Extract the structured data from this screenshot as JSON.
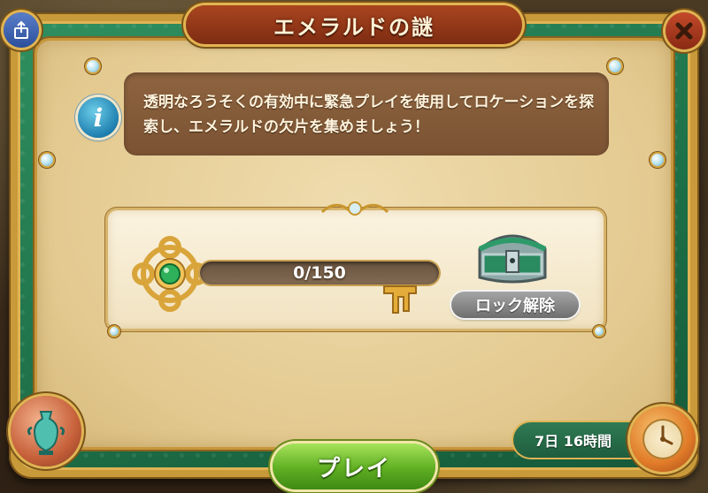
{
  "title": "エメラルドの謎",
  "info": {
    "text": "透明なろうそくの有効中に緊急プレイを使用してロケーションを探索し、エメラルドの欠片を集めましょう！",
    "icon": "i"
  },
  "progress": {
    "label": "0/150",
    "current": 0,
    "max": 150
  },
  "reward": {
    "chest_icon": "emerald-chest-icon",
    "unlock_label": "ロック解除"
  },
  "timer": {
    "label": "7日 16時間"
  },
  "play_label": "プレイ",
  "colors": {
    "frame_green": "#1d6e47",
    "gold": "#e0b453",
    "banner": "#8e3417",
    "play_green": "#5fae22",
    "info_blue": "#1f7fb0"
  }
}
